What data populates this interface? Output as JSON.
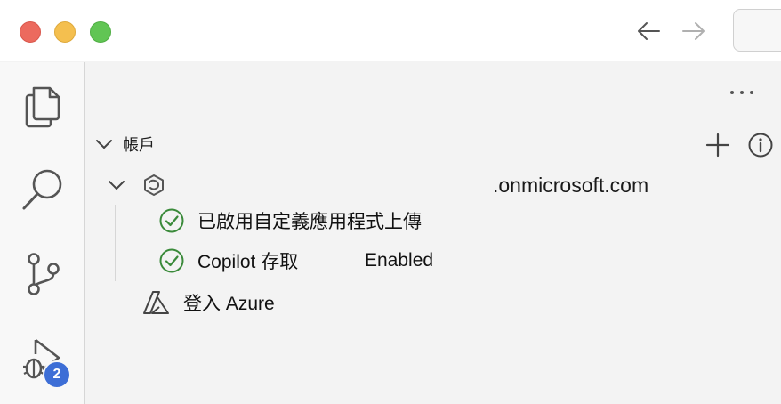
{
  "window": {
    "nav_back_icon": "arrow-left-icon",
    "nav_forward_icon": "arrow-right-icon"
  },
  "activity_bar": {
    "items": [
      {
        "icon": "files-icon"
      },
      {
        "icon": "search-icon"
      },
      {
        "icon": "source-control-icon"
      },
      {
        "icon": "run-debug-icon"
      }
    ],
    "debug_badge": "2"
  },
  "panel": {
    "more_actions": "···",
    "section": {
      "title": "帳戶",
      "add_icon": "plus-icon",
      "info_icon": "info-icon"
    },
    "account": {
      "name": ".onmicrosoft.com",
      "icon": "m365-icon"
    },
    "features": [
      {
        "label": "已啟用自定義應用程式上傳",
        "status": "",
        "icon": "check-circle-icon"
      },
      {
        "label": "Copilot 存取",
        "status": "Enabled",
        "icon": "check-circle-icon"
      }
    ],
    "azure": {
      "label": "登入 Azure",
      "icon": "azure-icon"
    }
  },
  "colors": {
    "check_green": "#3a8a3a",
    "badge_blue": "#3d6ed6",
    "icon_gray": "#555555"
  }
}
